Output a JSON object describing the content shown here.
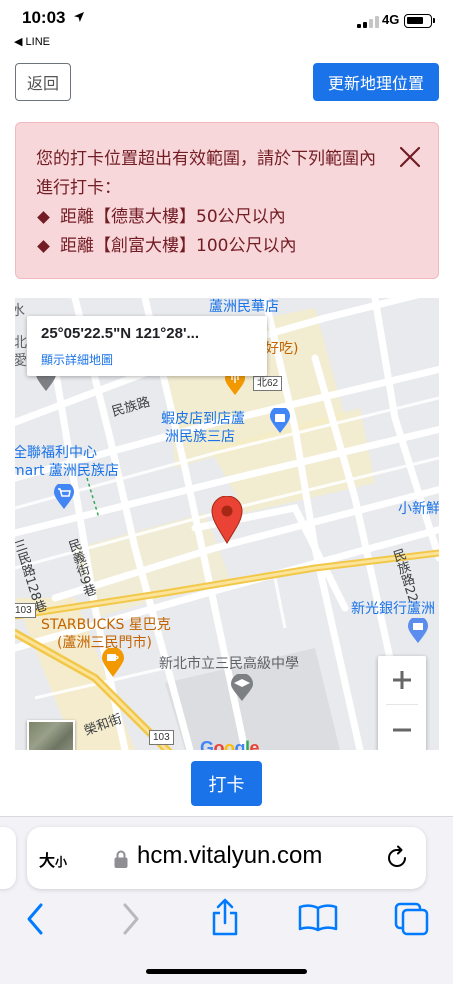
{
  "status_bar": {
    "time": "10:03",
    "back_app": "◀ LINE",
    "network": "4G",
    "signal_bars": 2,
    "battery_level": 0.7
  },
  "header": {
    "back_label": "返回",
    "update_location_label": "更新地理位置"
  },
  "alert": {
    "message": "您的打卡位置超出有效範圍，請於下列範圍內進行打卡：",
    "items": [
      "距離【德惠大樓】50公尺以內",
      "距離【創富大樓】100公尺以內"
    ],
    "color": "#721c24",
    "background": "#f8d7da"
  },
  "map": {
    "coords": "25°05'22.5\"N 121°28'...",
    "view_larger_map": "顯示詳細地圖",
    "labels": {
      "lujhou_minhua_store": "蘆洲民華店",
      "haochi": "好吃)",
      "bei62": "北62",
      "minzu_road": "民族路",
      "shrimp_shop_1": "蝦皮店到店蘆",
      "shrimp_shop_2": "洲民族三店",
      "pxmart_1": "全聯福利中心",
      "pxmart_2": "mart 蘆洲民族店",
      "xiaoxin": "小新鮮",
      "sanmin_lane": "三民路128巷",
      "minyi_street": "民義街9巷",
      "minzu_road_22": "民族路22",
      "shinkong_bank": "新光銀行蘆洲",
      "starbucks_1": "STARBUCKS 星巴克",
      "starbucks_2": "(蘆洲三民門市)",
      "sanmin_high_school": "新北市立三民高級中學",
      "road_103_a": "103",
      "road_103_b": "103",
      "rong_he_street": "榮和街",
      "edge_left_1": "水",
      "edge_left_2": "北",
      "edge_left_3": "愛"
    },
    "google_logo": "Google",
    "pin_color": "#ea4335"
  },
  "punch_button": "打卡",
  "safari": {
    "text_size_label": "大",
    "text_size_small": "小",
    "url": "hcm.vitalyun.com"
  },
  "colors": {
    "primary": "#1a73e8",
    "safari_blue": "#007aff"
  }
}
